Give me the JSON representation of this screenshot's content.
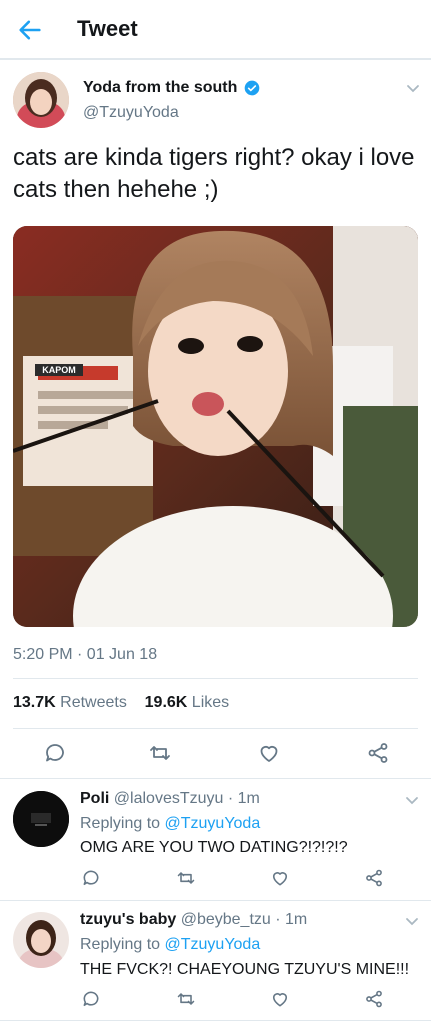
{
  "header": {
    "title": "Tweet"
  },
  "tweet": {
    "author_name": "Yoda from the south",
    "author_handle": "@TzuyuYoda",
    "text": "cats are kinda tigers right? okay i love cats then hehehe ;)",
    "media_watermark": "KAPOM",
    "timestamp": "5:20 PM · 01 Jun 18",
    "retweets_count": "13.7K",
    "retweets_label": "Retweets",
    "likes_count": "19.6K",
    "likes_label": "Likes"
  },
  "replies": [
    {
      "name": "Poli",
      "handle_time": "@lalovesTzuyu · 1m",
      "replying_prefix": "Replying to",
      "replying_to": "@TzuyuYoda",
      "text": "OMG ARE YOU TWO DATING?!?!?!?"
    },
    {
      "name": "tzuyu's baby",
      "handle_time": "@beybe_tzu · 1m",
      "replying_prefix": "Replying to",
      "replying_to": "@TzuyuYoda",
      "text": "THE FVCK?! CHAEYOUNG TZUYU'S MINE!!!"
    }
  ],
  "colors": {
    "accent": "#1da1f2",
    "muted": "#657786",
    "border": "#e1e8ed",
    "text": "#14171a"
  },
  "icons": [
    "back-arrow-icon",
    "verified-badge-icon",
    "chevron-down-icon",
    "reply-icon",
    "retweet-icon",
    "like-icon",
    "share-icon"
  ]
}
